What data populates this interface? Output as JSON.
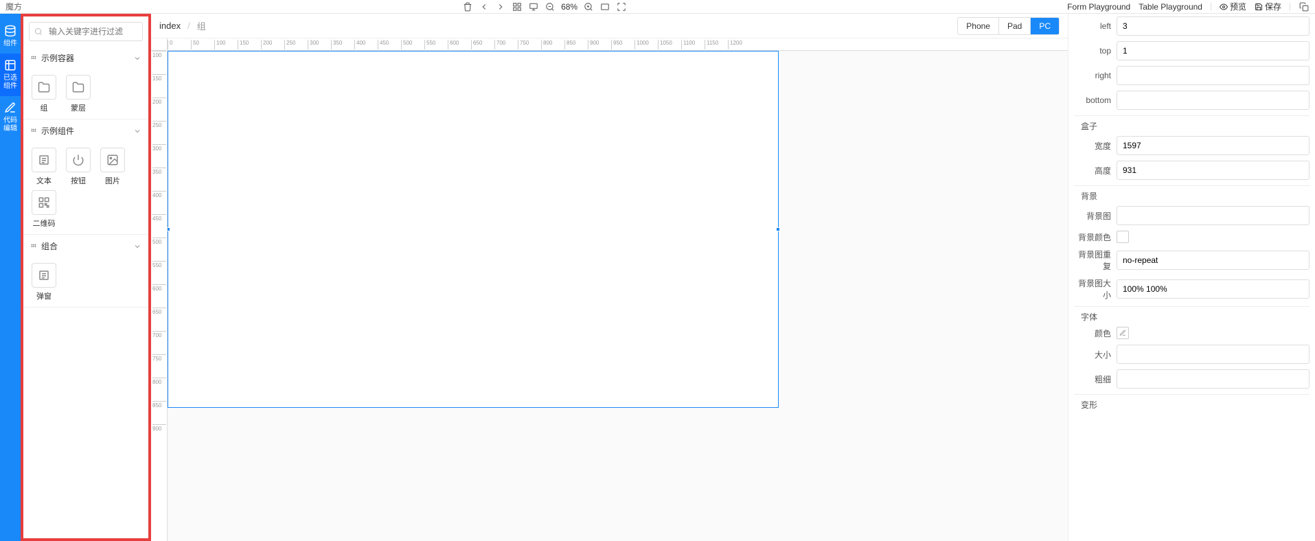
{
  "app_title": "魔方",
  "topbar": {
    "zoom": "68%",
    "form_playground": "Form Playground",
    "table_playground": "Table Playground",
    "preview": "预览",
    "save": "保存"
  },
  "rail": {
    "components": "组件",
    "selected": "已选\n组件",
    "code_edit": "代码\n编辑"
  },
  "components": {
    "search_placeholder": "输入关键字进行过滤",
    "sections": {
      "containers": {
        "title": "示例容器"
      },
      "widgets": {
        "title": "示例组件"
      },
      "compose": {
        "title": "组合"
      }
    },
    "items": {
      "group": "组",
      "mask": "蒙层",
      "text": "文本",
      "button": "按钮",
      "image": "图片",
      "qrcode": "二维码",
      "dialog": "弹窗"
    }
  },
  "breadcrumb": {
    "root": "index",
    "current": "组"
  },
  "devices": {
    "phone": "Phone",
    "pad": "Pad",
    "pc": "PC"
  },
  "props": {
    "position": {
      "left_label": "left",
      "left_value": "3",
      "top_label": "top",
      "top_value": "1",
      "right_label": "right",
      "right_value": "",
      "bottom_label": "bottom",
      "bottom_value": ""
    },
    "box": {
      "title": "盒子",
      "width_label": "宽度",
      "width_value": "1597",
      "height_label": "高度",
      "height_value": "931"
    },
    "background": {
      "title": "背景",
      "image_label": "背景图",
      "image_value": "",
      "color_label": "背景颜色",
      "repeat_label": "背景图重复",
      "repeat_value": "no-repeat",
      "size_label": "背景图大小",
      "size_value": "100% 100%"
    },
    "font": {
      "title": "字体",
      "color_label": "颜色",
      "size_label": "大小",
      "size_value": "",
      "weight_label": "粗细",
      "weight_value": ""
    },
    "transform": {
      "title": "变形"
    }
  }
}
